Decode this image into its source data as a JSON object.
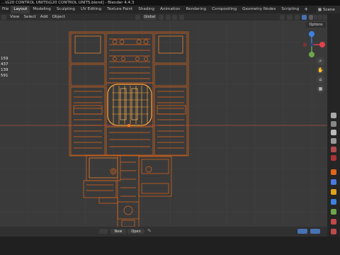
{
  "window": {
    "title": "...\\G20 CONTROL UNITS\\G20 CONTROL UNITS.blend] - Blender 4.4.3"
  },
  "topbar": {
    "app_menu": "File",
    "workspaces": [
      "Layout",
      "Modeling",
      "Sculpting",
      "UV Editing",
      "Texture Paint",
      "Shading",
      "Animation",
      "Rendering",
      "Compositing",
      "Geometry Nodes",
      "Scripting"
    ],
    "active_workspace": "Layout",
    "scene_label": "Scene"
  },
  "viewport_header": {
    "menus": [
      "View",
      "Select",
      "Add",
      "Object"
    ],
    "orientation": "Global",
    "options_label": "Options"
  },
  "stats": [
    "159",
    "437",
    "139",
    "591"
  ],
  "bottom_bar": {
    "new_label": "New",
    "open_label": "Open"
  },
  "colors": {
    "accent": "#ff7a1a",
    "wire": "#e0661a",
    "active_tab": "#3b3b3b",
    "axis_x": "#e5424c",
    "axis_y": "#6ea64a",
    "axis_z": "#3e82e0"
  },
  "icons": {
    "gizmo_x": "x-axis-icon",
    "gizmo_y": "y-axis-icon",
    "gizmo_z": "z-axis-icon",
    "zoom": "zoom-icon",
    "pan": "hand-icon",
    "camera": "camera-icon",
    "grid": "grid-icon"
  }
}
